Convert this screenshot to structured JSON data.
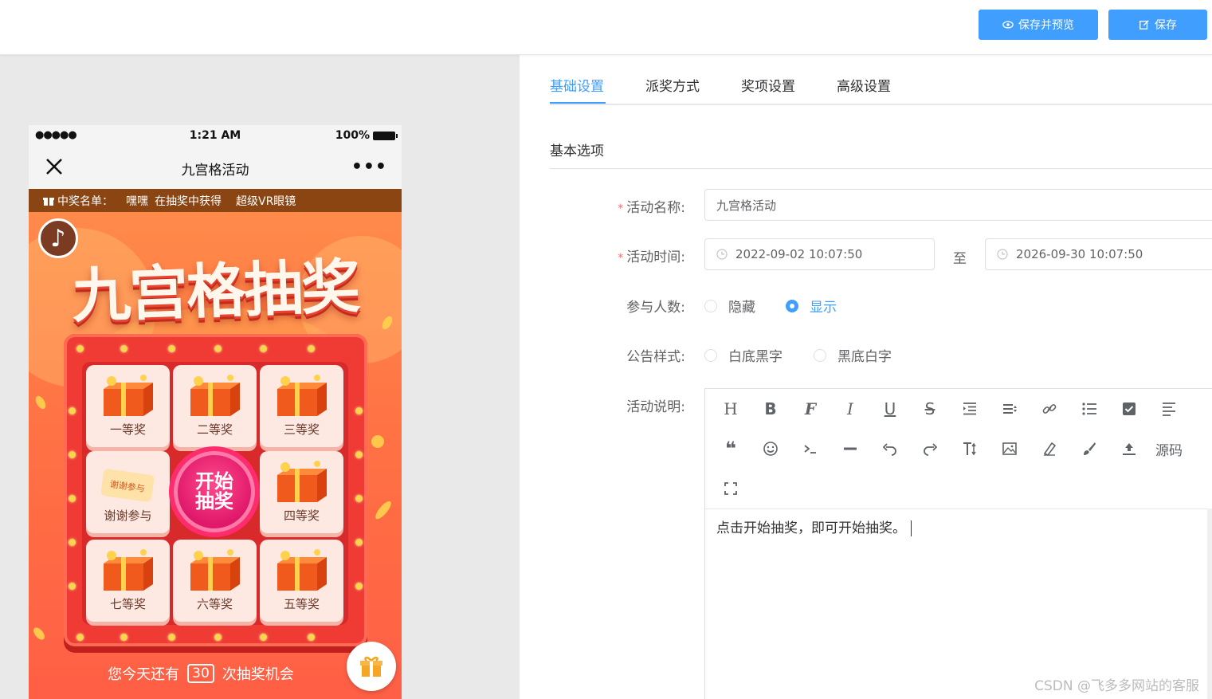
{
  "toolbar": {
    "preview_label": "保存并预览",
    "save_label": "保存"
  },
  "phone": {
    "status": {
      "signal": "●●●●●",
      "time": "1:21 AM",
      "battery": "100%"
    },
    "nav_title": "九宫格活动",
    "notice": {
      "label": "中奖名单：",
      "winner": "嘿嘿",
      "middle": "在抽奖中获得",
      "prize": "超级VR眼镜"
    },
    "banner_title": "九宫格抽奖",
    "cells": [
      "一等奖",
      "二等奖",
      "三等奖",
      "谢谢参与",
      "四等奖",
      "七等奖",
      "六等奖",
      "五等奖"
    ],
    "thanks_card": "谢谢参与",
    "start_label": "开始抽奖",
    "chance": {
      "prefix": "您今天还有",
      "count": "30",
      "suffix": "次抽奖机会"
    }
  },
  "tabs": [
    {
      "label": "基础设置",
      "active": true
    },
    {
      "label": "派奖方式",
      "active": false
    },
    {
      "label": "奖项设置",
      "active": false
    },
    {
      "label": "高级设置",
      "active": false
    }
  ],
  "form": {
    "section_title": "基本选项",
    "name": {
      "label": "活动名称:",
      "value": "九宫格活动"
    },
    "time": {
      "label": "活动时间:",
      "start": "2022-09-02 10:07:50",
      "sep": "至",
      "end": "2026-09-30 10:07:50"
    },
    "participants": {
      "label": "参与人数:",
      "options": [
        "隐藏",
        "显示"
      ],
      "selected": "显示"
    },
    "notice_style": {
      "label": "公告样式:",
      "options": [
        "白底黑字",
        "黑底白字"
      ],
      "selected": ""
    },
    "description": {
      "label": "活动说明:",
      "source_label": "源码",
      "content": "点击开始抽奖，即可开始抽奖。"
    }
  },
  "watermark": "CSDN @飞多多网站的客服",
  "colors": {
    "primary": "#409eff",
    "notice_bg": "#8b4513",
    "board": "#ef3b34",
    "start": "#e0186a"
  }
}
